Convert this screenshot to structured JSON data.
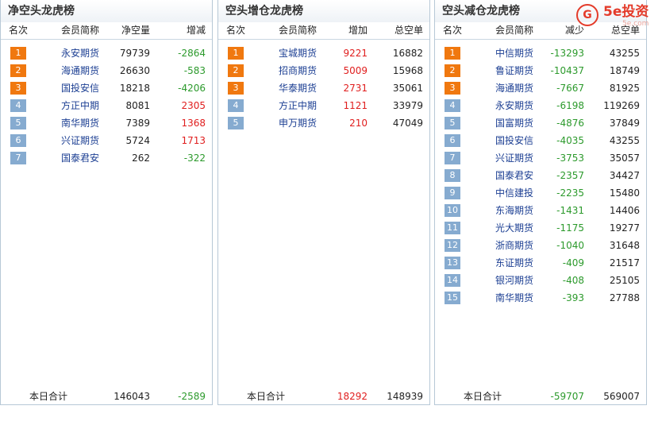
{
  "logo": {
    "text": "5e投资",
    "sub": "5e.com"
  },
  "panels": [
    {
      "title": "净空头龙虎榜",
      "headers": [
        "名次",
        "会员简称",
        "净空量",
        "增减"
      ],
      "rows": [
        {
          "rank": "1",
          "name": "永安期货",
          "v1": "79739",
          "v2": "-2864",
          "v2sign": "neg"
        },
        {
          "rank": "2",
          "name": "海通期货",
          "v1": "26630",
          "v2": "-583",
          "v2sign": "neg"
        },
        {
          "rank": "3",
          "name": "国投安信",
          "v1": "18218",
          "v2": "-4206",
          "v2sign": "neg"
        },
        {
          "rank": "4",
          "name": "方正中期",
          "v1": "8081",
          "v2": "2305",
          "v2sign": "pos"
        },
        {
          "rank": "5",
          "name": "南华期货",
          "v1": "7389",
          "v2": "1368",
          "v2sign": "pos"
        },
        {
          "rank": "6",
          "name": "兴证期货",
          "v1": "5724",
          "v2": "1713",
          "v2sign": "pos"
        },
        {
          "rank": "7",
          "name": "国泰君安",
          "v1": "262",
          "v2": "-322",
          "v2sign": "neg"
        }
      ],
      "total": {
        "label": "本日合计",
        "v1": "146043",
        "v2": "-2589",
        "v1sign": "",
        "v2sign": "neg"
      }
    },
    {
      "title": "空头增仓龙虎榜",
      "headers": [
        "名次",
        "会员简称",
        "增加",
        "总空单"
      ],
      "rows": [
        {
          "rank": "1",
          "name": "宝城期货",
          "v1": "9221",
          "v2": "16882",
          "v1sign": "pos"
        },
        {
          "rank": "2",
          "name": "招商期货",
          "v1": "5009",
          "v2": "15968",
          "v1sign": "pos"
        },
        {
          "rank": "3",
          "name": "华泰期货",
          "v1": "2731",
          "v2": "35061",
          "v1sign": "pos"
        },
        {
          "rank": "4",
          "name": "方正中期",
          "v1": "1121",
          "v2": "33979",
          "v1sign": "pos"
        },
        {
          "rank": "5",
          "name": "申万期货",
          "v1": "210",
          "v2": "47049",
          "v1sign": "pos"
        }
      ],
      "total": {
        "label": "本日合计",
        "v1": "18292",
        "v2": "148939",
        "v1sign": "pos",
        "v2sign": ""
      }
    },
    {
      "title": "空头减仓龙虎榜",
      "headers": [
        "名次",
        "会员简称",
        "减少",
        "总空单"
      ],
      "rows": [
        {
          "rank": "1",
          "name": "中信期货",
          "v1": "-13293",
          "v2": "43255",
          "v1sign": "neg"
        },
        {
          "rank": "2",
          "name": "鲁证期货",
          "v1": "-10437",
          "v2": "18749",
          "v1sign": "neg"
        },
        {
          "rank": "3",
          "name": "海通期货",
          "v1": "-7667",
          "v2": "81925",
          "v1sign": "neg"
        },
        {
          "rank": "4",
          "name": "永安期货",
          "v1": "-6198",
          "v2": "119269",
          "v1sign": "neg"
        },
        {
          "rank": "5",
          "name": "国富期货",
          "v1": "-4876",
          "v2": "37849",
          "v1sign": "neg"
        },
        {
          "rank": "6",
          "name": "国投安信",
          "v1": "-4035",
          "v2": "43255",
          "v1sign": "neg"
        },
        {
          "rank": "7",
          "name": "兴证期货",
          "v1": "-3753",
          "v2": "35057",
          "v1sign": "neg"
        },
        {
          "rank": "8",
          "name": "国泰君安",
          "v1": "-2357",
          "v2": "34427",
          "v1sign": "neg"
        },
        {
          "rank": "9",
          "name": "中信建投",
          "v1": "-2235",
          "v2": "15480",
          "v1sign": "neg"
        },
        {
          "rank": "10",
          "name": "东海期货",
          "v1": "-1431",
          "v2": "14406",
          "v1sign": "neg"
        },
        {
          "rank": "11",
          "name": "光大期货",
          "v1": "-1175",
          "v2": "19277",
          "v1sign": "neg"
        },
        {
          "rank": "12",
          "name": "浙商期货",
          "v1": "-1040",
          "v2": "31648",
          "v1sign": "neg"
        },
        {
          "rank": "13",
          "name": "东证期货",
          "v1": "-409",
          "v2": "21517",
          "v1sign": "neg"
        },
        {
          "rank": "14",
          "name": "银河期货",
          "v1": "-408",
          "v2": "25105",
          "v1sign": "neg"
        },
        {
          "rank": "15",
          "name": "南华期货",
          "v1": "-393",
          "v2": "27788",
          "v1sign": "neg"
        }
      ],
      "total": {
        "label": "本日合计",
        "v1": "-59707",
        "v2": "569007",
        "v1sign": "neg",
        "v2sign": ""
      }
    }
  ]
}
